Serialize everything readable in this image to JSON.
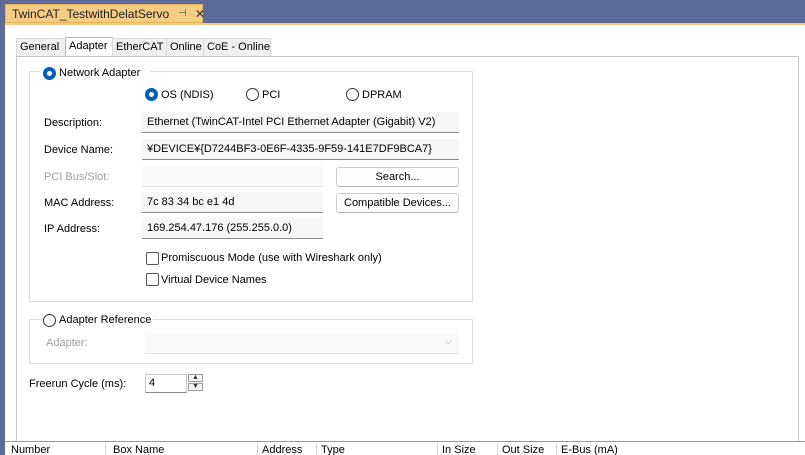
{
  "document_tab": {
    "title": "TwinCAT_TestwithDelatServo",
    "pin_icon": "⊣",
    "close_icon": "✕"
  },
  "tabs": [
    "General",
    "Adapter",
    "EtherCAT",
    "Online",
    "CoE - Online"
  ],
  "active_tab": "Adapter",
  "network_adapter": {
    "label": "Network Adapter",
    "selected": true,
    "modes": [
      {
        "label": "OS (NDIS)",
        "selected": true
      },
      {
        "label": "PCI",
        "selected": false
      },
      {
        "label": "DPRAM",
        "selected": false
      }
    ],
    "description": {
      "label": "Description:",
      "value": "Ethernet (TwinCAT-Intel PCI Ethernet Adapter (Gigabit) V2)"
    },
    "device_name": {
      "label": "Device Name:",
      "value": "¥DEVICE¥{D7244BF3-0E6F-4335-9F59-141E7DF9BCA7}"
    },
    "pci_bus_slot": {
      "label": "PCI Bus/Slot:",
      "value": ""
    },
    "search_button": "Search...",
    "mac_address": {
      "label": "MAC Address:",
      "value": "7c 83 34 bc e1 4d"
    },
    "compatible_button": "Compatible Devices...",
    "ip_address": {
      "label": "IP Address:",
      "value": "169.254.47.176 (255.255.0.0)"
    },
    "promiscuous": {
      "label": "Promiscuous Mode (use with Wireshark only)",
      "checked": false
    },
    "virtual_names": {
      "label": "Virtual Device Names",
      "checked": false
    }
  },
  "adapter_reference": {
    "label": "Adapter Reference",
    "selected": false,
    "adapter_label": "Adapter:",
    "adapter_value": ""
  },
  "freerun": {
    "label": "Freerun Cycle (ms):",
    "value": "4",
    "up_icon": "▲",
    "down_icon": "▼"
  },
  "bottom_columns": [
    "Number",
    "Box Name",
    "Address",
    "Type",
    "In Size",
    "Out Size",
    "E-Bus (mA)"
  ]
}
